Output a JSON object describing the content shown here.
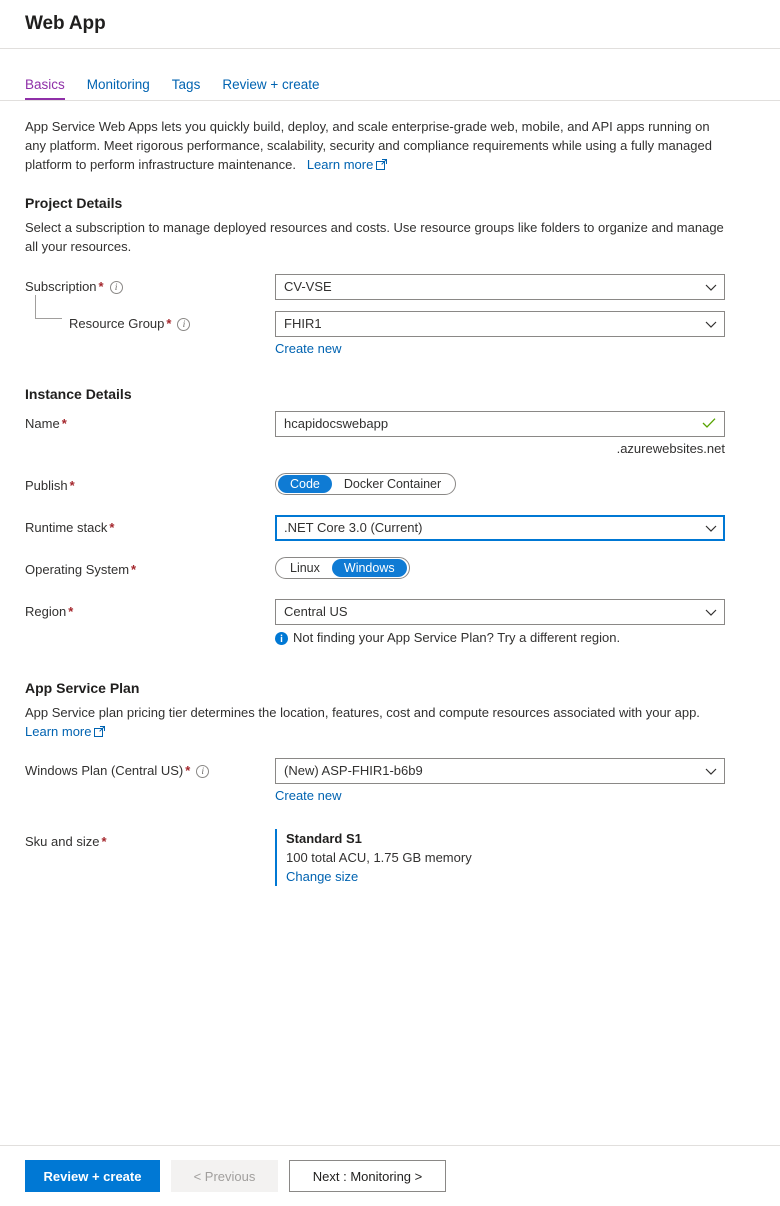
{
  "header": {
    "title": "Web App"
  },
  "tabs": [
    {
      "label": "Basics",
      "active": true
    },
    {
      "label": "Monitoring",
      "active": false
    },
    {
      "label": "Tags",
      "active": false
    },
    {
      "label": "Review + create",
      "active": false
    }
  ],
  "intro": {
    "text": "App Service Web Apps lets you quickly build, deploy, and scale enterprise-grade web, mobile, and API apps running on any platform. Meet rigorous performance, scalability, security and compliance requirements while using a fully managed platform to perform infrastructure maintenance.",
    "learn_more": "Learn more",
    "learn_more_icon": "external-link-icon"
  },
  "project_details": {
    "heading": "Project Details",
    "description": "Select a subscription to manage deployed resources and costs. Use resource groups like folders to organize and manage all your resources.",
    "subscription": {
      "label": "Subscription",
      "required": "*",
      "info_icon": "info-circle-icon",
      "value": "CV-VSE",
      "chevron_icon": "chevron-down-icon"
    },
    "resource_group": {
      "label": "Resource Group",
      "required": "*",
      "info_icon": "info-circle-icon",
      "value": "FHIR1",
      "chevron_icon": "chevron-down-icon",
      "create_new": "Create new"
    }
  },
  "instance_details": {
    "heading": "Instance Details",
    "name": {
      "label": "Name",
      "required": "*",
      "value": "hcapidocswebapp",
      "valid_icon": "checkmark-icon",
      "suffix": ".azurewebsites.net"
    },
    "publish": {
      "label": "Publish",
      "required": "*",
      "options": [
        "Code",
        "Docker Container"
      ],
      "selected": "Code"
    },
    "runtime_stack": {
      "label": "Runtime stack",
      "required": "*",
      "value": ".NET Core 3.0 (Current)",
      "chevron_icon": "chevron-down-icon",
      "focused": true
    },
    "operating_system": {
      "label": "Operating System",
      "required": "*",
      "options": [
        "Linux",
        "Windows"
      ],
      "selected": "Windows"
    },
    "region": {
      "label": "Region",
      "required": "*",
      "value": "Central US",
      "chevron_icon": "chevron-down-icon",
      "hint_icon": "info-filled-icon",
      "hint": "Not finding your App Service Plan? Try a different region."
    }
  },
  "app_service_plan": {
    "heading": "App Service Plan",
    "description": "App Service plan pricing tier determines the location, features, cost and compute resources associated with your app.",
    "learn_more": "Learn more",
    "learn_more_icon": "external-link-icon",
    "windows_plan": {
      "label": "Windows Plan (Central US)",
      "required": "*",
      "info_icon": "info-circle-icon",
      "value": "(New) ASP-FHIR1-b6b9",
      "chevron_icon": "chevron-down-icon",
      "create_new": "Create new"
    },
    "sku_and_size": {
      "label": "Sku and size",
      "required": "*",
      "tier": "Standard S1",
      "details": "100 total ACU, 1.75 GB memory",
      "change_link": "Change size"
    }
  },
  "footer": {
    "review_create": "Review + create",
    "previous": "< Previous",
    "next": "Next : Monitoring >"
  },
  "colors": {
    "accent_blue": "#0078d4",
    "link_blue": "#0063b1",
    "active_tab_purple": "#8f2fa8",
    "required_red": "#a4262c",
    "valid_green": "#57a300",
    "toggle_blue": "#0f7bd4"
  }
}
